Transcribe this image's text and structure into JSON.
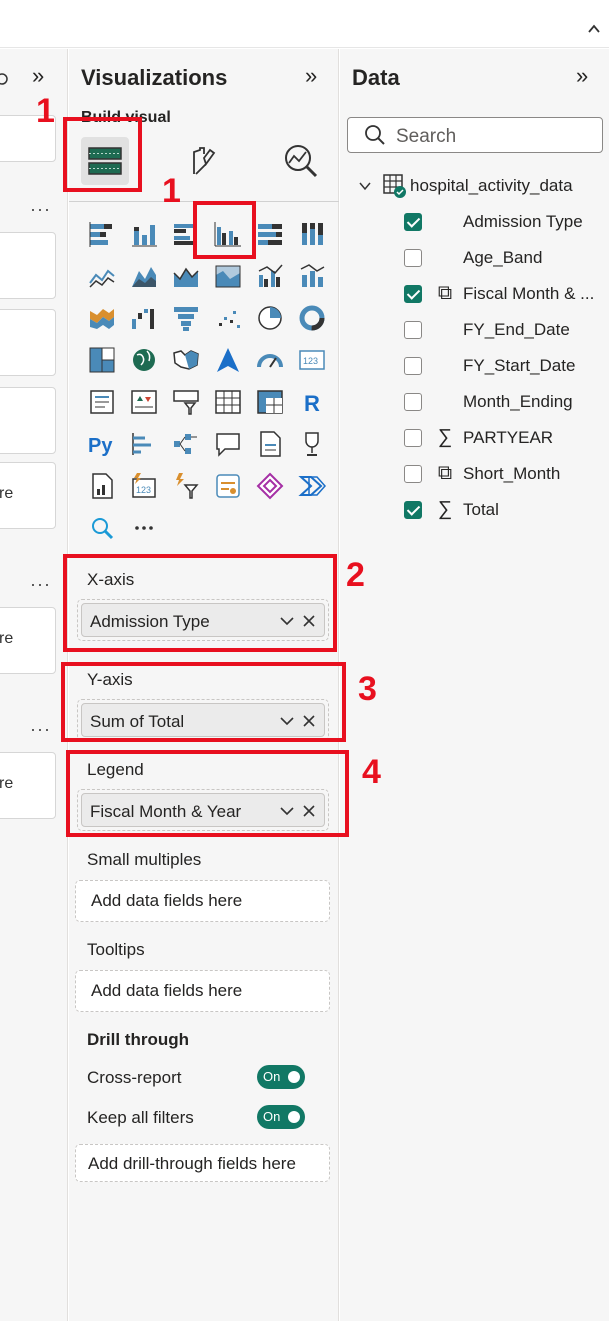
{
  "visualizations": {
    "title": "Visualizations",
    "build_label": "Build visual",
    "more_label": "···"
  },
  "wells": {
    "x_axis": {
      "title": "X-axis",
      "field": "Admission Type"
    },
    "y_axis": {
      "title": "Y-axis",
      "field": "Sum of Total"
    },
    "legend": {
      "title": "Legend",
      "field": "Fiscal Month & Year"
    },
    "small_multiples": {
      "title": "Small multiples",
      "placeholder": "Add data fields here"
    },
    "tooltips": {
      "title": "Tooltips",
      "placeholder": "Add data fields here"
    }
  },
  "drill_through": {
    "title": "Drill through",
    "cross_report": {
      "label": "Cross-report",
      "state": "On"
    },
    "keep_filters": {
      "label": "Keep all filters",
      "state": "On"
    },
    "placeholder": "Add drill-through fields here"
  },
  "data": {
    "title": "Data",
    "search_placeholder": "Search",
    "table_name": "hospital_activity_data",
    "fields": [
      {
        "label": "Admission Type",
        "checked": true,
        "icon": ""
      },
      {
        "label": "Age_Band",
        "checked": false,
        "icon": ""
      },
      {
        "label": "Fiscal Month & ...",
        "checked": true,
        "icon": "calc-icon"
      },
      {
        "label": "FY_End_Date",
        "checked": false,
        "icon": ""
      },
      {
        "label": "FY_Start_Date",
        "checked": false,
        "icon": ""
      },
      {
        "label": "Month_Ending",
        "checked": false,
        "icon": ""
      },
      {
        "label": "PARTYEAR",
        "checked": false,
        "icon": "sigma-icon"
      },
      {
        "label": "Short_Month",
        "checked": false,
        "icon": "calc-icon"
      },
      {
        "label": "Total",
        "checked": true,
        "icon": "sigma-icon"
      }
    ]
  },
  "left_pane": {
    "truncated_text": [
      "re",
      "re",
      "re"
    ],
    "more_label": "···"
  },
  "annotations": [
    "1",
    "1",
    "2",
    "3",
    "4"
  ],
  "colors": {
    "accent": "#117865",
    "annotation": "#e8101f",
    "pane_bg": "#f6f6f6"
  }
}
